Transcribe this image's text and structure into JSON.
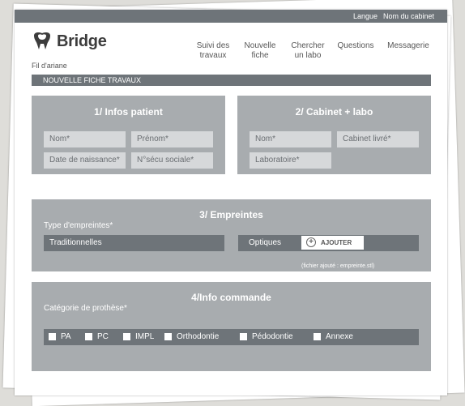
{
  "topbar": {
    "language": "Langue",
    "cabinet": "Nom du cabinet"
  },
  "logo": {
    "name": "Bridge",
    "icon": "tooth-icon"
  },
  "nav": [
    {
      "line1": "Suivi des",
      "line2": "travaux"
    },
    {
      "line1": "Nouvelle",
      "line2": "fiche"
    },
    {
      "line1": "Chercher",
      "line2": "un labo"
    },
    {
      "line1": "Questions",
      "line2": ""
    },
    {
      "line1": "Messagerie",
      "line2": ""
    }
  ],
  "breadcrumb": "Fil d'ariane",
  "page_title": "NOUVELLE FICHE TRAVAUX",
  "section1": {
    "title": "1/ Infos patient",
    "nom": "Nom*",
    "prenom": "Prénom*",
    "date_naissance": "Date de naissance*",
    "secu": "N°sécu sociale*"
  },
  "section2": {
    "title": "2/ Cabinet + labo",
    "nom": "Nom*",
    "cabinet_livre": "Cabinet livré*",
    "laboratoire": "Laboratoire*"
  },
  "section3": {
    "title": "3/ Empreintes",
    "type_label": "Type d'empreintes*",
    "traditionnelles": "Traditionnelles",
    "optiques": "Optiques",
    "add_button": "AJOUTER",
    "add_icon": "plus-circle-icon",
    "note": "(fichier ajouté : empreinte.stl)"
  },
  "section4": {
    "title": "4/Info commande",
    "category_label": "Catégorie de prothèse*",
    "categories": [
      "PA",
      "PC",
      "IMPL",
      "Orthodontie",
      "Pédodontie",
      "Annexe"
    ]
  },
  "colors": {
    "panel": "#a8acaf",
    "dark": "#6e7479",
    "field": "#d6d8da"
  }
}
